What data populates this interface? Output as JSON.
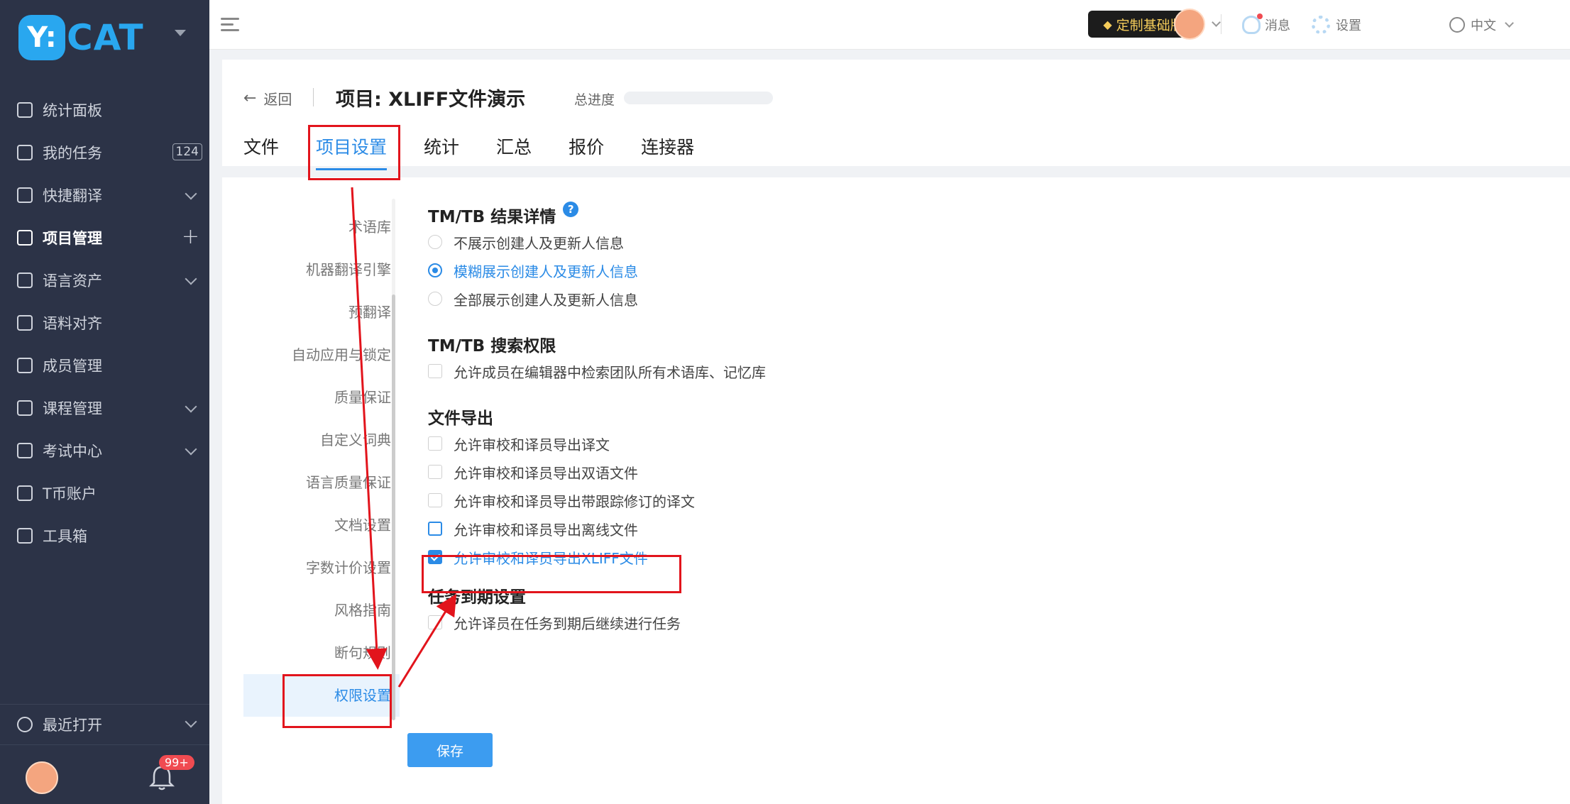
{
  "app": {
    "logo_text": "Y: CAT"
  },
  "sidebar": {
    "items": [
      {
        "label": "统计面板"
      },
      {
        "label": "我的任务",
        "badge": "124"
      },
      {
        "label": "快捷翻译"
      },
      {
        "label": "项目管理"
      },
      {
        "label": "语言资产"
      },
      {
        "label": "语料对齐"
      },
      {
        "label": "成员管理"
      },
      {
        "label": "课程管理"
      },
      {
        "label": "考试中心"
      },
      {
        "label": "T币账户"
      },
      {
        "label": "工具箱"
      }
    ],
    "recent_label": "最近打开",
    "notif_badge": "99+"
  },
  "topbar": {
    "upgrade_label": "定制基础版",
    "messages_label": "消息",
    "settings_label": "设置",
    "language_label": "中文"
  },
  "project": {
    "back_label": "返回",
    "title": "项目: XLIFF文件演示",
    "progress_label": "总进度",
    "progress_fraction": 0,
    "tabs": [
      {
        "label": "文件"
      },
      {
        "label": "项目设置"
      },
      {
        "label": "统计"
      },
      {
        "label": "汇总"
      },
      {
        "label": "报价"
      },
      {
        "label": "连接器"
      }
    ]
  },
  "subnav": {
    "items": [
      {
        "label": "术语库"
      },
      {
        "label": "机器翻译引擎"
      },
      {
        "label": "预翻译"
      },
      {
        "label": "自动应用与锁定"
      },
      {
        "label": "质量保证"
      },
      {
        "label": "自定义词典"
      },
      {
        "label": "语言质量保证"
      },
      {
        "label": "文档设置"
      },
      {
        "label": "字数计价设置"
      },
      {
        "label": "风格指南"
      },
      {
        "label": "断句规则"
      },
      {
        "label": "权限设置"
      }
    ]
  },
  "settings": {
    "tmtb_details": {
      "title": "TM/TB 结果详情",
      "help": "?",
      "options": [
        "不展示创建人及更新人信息",
        "模糊展示创建人及更新人信息",
        "全部展示创建人及更新人信息"
      ]
    },
    "tmtb_search": {
      "title": "TM/TB 搜索权限",
      "options": [
        "允许成员在编辑器中检索团队所有术语库、记忆库"
      ]
    },
    "file_export": {
      "title": "文件导出",
      "options": [
        "允许审校和译员导出译文",
        "允许审校和译员导出双语文件",
        "允许审校和译员导出带跟踪修订的译文",
        "允许审校和译员导出离线文件",
        "允许审校和译员导出XLIFF文件"
      ]
    },
    "task_due": {
      "title": "任务到期设置",
      "options": [
        "允许译员在任务到期后继续进行任务"
      ]
    }
  },
  "save_label": "保存"
}
